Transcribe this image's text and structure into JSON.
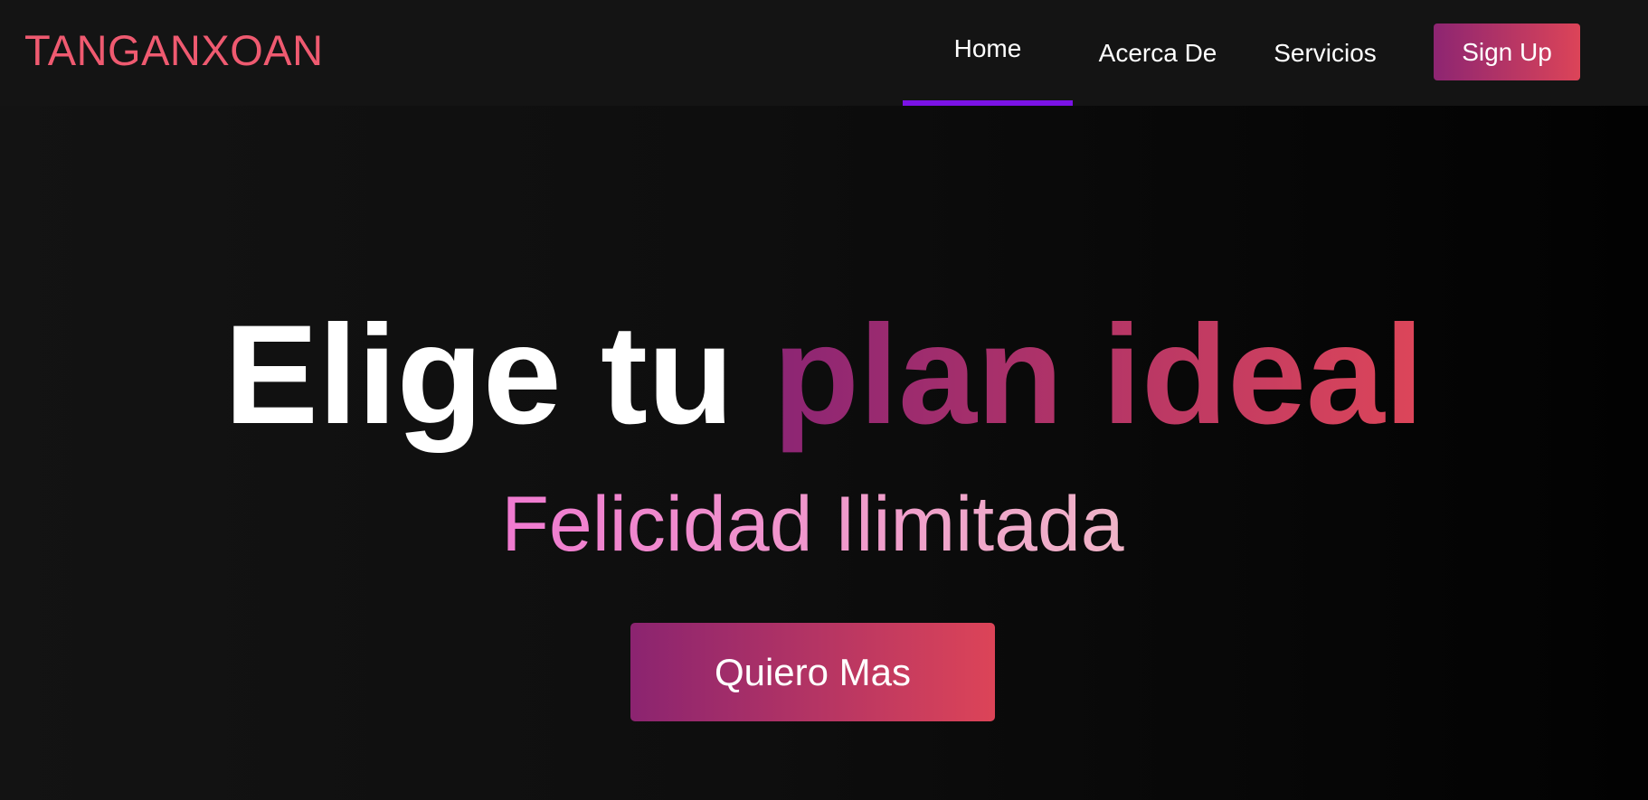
{
  "brand": {
    "logo": "TANGANXOAN",
    "accent": "#ef5a70"
  },
  "nav": {
    "items": [
      {
        "label": "Home",
        "active": true
      },
      {
        "label": "Acerca De"
      },
      {
        "label": "Servicios"
      }
    ],
    "active_indicator_color": "#7b12e6",
    "signup_label": "Sign Up"
  },
  "hero": {
    "title_plain": "Elige tu",
    "title_highlight": "plan ideal",
    "subtitle": "Felicidad Ilimitada",
    "cta_label": "Quiero Mas",
    "gradient": [
      "#8c2574",
      "#dd4659"
    ]
  }
}
